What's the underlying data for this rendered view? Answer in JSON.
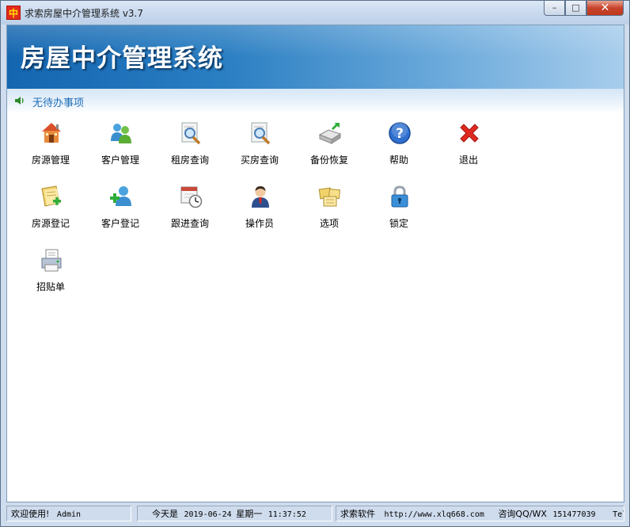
{
  "window": {
    "title": "求索房屋中介管理系统 v3.7",
    "icon_glyph": "中"
  },
  "controls": {
    "minimize": "–",
    "maximize": "□",
    "close": "✕"
  },
  "banner": {
    "title": "房屋中介管理系统"
  },
  "notice": {
    "text": "无待办事项",
    "icon": "speaker-icon"
  },
  "icons": [
    {
      "label": "房源管理",
      "icon": "house-icon"
    },
    {
      "label": "客户管理",
      "icon": "users-icon"
    },
    {
      "label": "租房查询",
      "icon": "search-doc-icon"
    },
    {
      "label": "买房查询",
      "icon": "search-doc-icon"
    },
    {
      "label": "备份恢复",
      "icon": "backup-icon"
    },
    {
      "label": "帮助",
      "icon": "help-icon"
    },
    {
      "label": "退出",
      "icon": "exit-icon"
    },
    {
      "label": "房源登记",
      "icon": "register-house-icon"
    },
    {
      "label": "客户登记",
      "icon": "add-user-icon"
    },
    {
      "label": "跟进查询",
      "icon": "calendar-clock-icon"
    },
    {
      "label": "操作员",
      "icon": "operator-icon"
    },
    {
      "label": "选项",
      "icon": "notes-icon"
    },
    {
      "label": "锁定",
      "icon": "lock-icon"
    },
    {
      "label": "招贴单",
      "icon": "printer-icon"
    }
  ],
  "status": {
    "welcome": "欢迎使用!",
    "user": "Admin",
    "today_label": "今天是",
    "date": "2019-06-24",
    "weekday": "星期一",
    "time": "11:37:52",
    "company": "求索软件",
    "url": "http://www.xlq668.com",
    "contact_label": "咨询QQ/WX",
    "contact_number": "151477039",
    "tel_label": "Tel"
  }
}
